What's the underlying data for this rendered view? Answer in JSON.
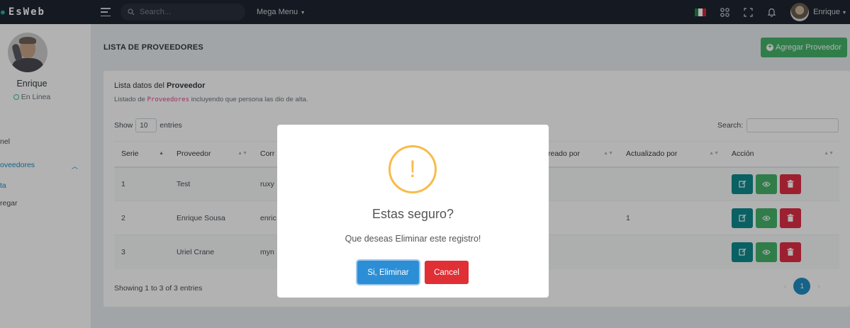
{
  "brand": {
    "name": "EsWeb"
  },
  "topbar": {
    "search_placeholder": "Search...",
    "mega_menu": "Mega Menu",
    "user_name": "Enrique",
    "icons": [
      "menu-icon",
      "search-icon",
      "flag-mexico",
      "apps-icon",
      "fullscreen-icon",
      "bell-icon"
    ]
  },
  "sidebar": {
    "user_name": "Enrique",
    "status": "En Linea",
    "items": [
      {
        "label": "nel"
      },
      {
        "label": "oveedores"
      },
      {
        "label": "ta"
      },
      {
        "label": "regar"
      }
    ]
  },
  "page": {
    "title": "LISTA DE PROVEEDORES",
    "add_button": "Agregar Proveedor"
  },
  "card": {
    "title_prefix": "Lista datos del ",
    "title_bold": "Proveedor",
    "sub_prefix": "Listado de ",
    "sub_code": "Proveedores",
    "sub_suffix": " incluyendo que persona las dio de alta.",
    "show_label": "Show",
    "entries_value": "10",
    "entries_label": "entries",
    "search_label": "Search:",
    "showing": "Showing 1 to 3 of 3 entries",
    "current_page": "1"
  },
  "table": {
    "headers": [
      "Serie",
      "Proveedor",
      "Corr",
      "reado por",
      "Actualizado por",
      "Acción"
    ],
    "rows": [
      {
        "serie": "1",
        "proveedor": "Test",
        "correo": "ruxy",
        "creado": "",
        "actualizado": ""
      },
      {
        "serie": "2",
        "proveedor": "Enrique Sousa",
        "correo": "enric",
        "creado": "",
        "actualizado": "1"
      },
      {
        "serie": "3",
        "proveedor": "Uriel Crane",
        "correo": "myn",
        "creado": "",
        "actualizado": ""
      }
    ]
  },
  "modal": {
    "icon": "!",
    "title": "Estas seguro?",
    "text": "Que deseas Eliminar este registro!",
    "confirm": "Si, Eliminar",
    "cancel": "Cancel"
  },
  "colors": {
    "topbar": "#1f2530",
    "accent": "#1f8ec5",
    "success": "#45b36a",
    "danger": "#e02f45",
    "teal": "#0e8b8e",
    "warning": "#f8bb4c"
  }
}
